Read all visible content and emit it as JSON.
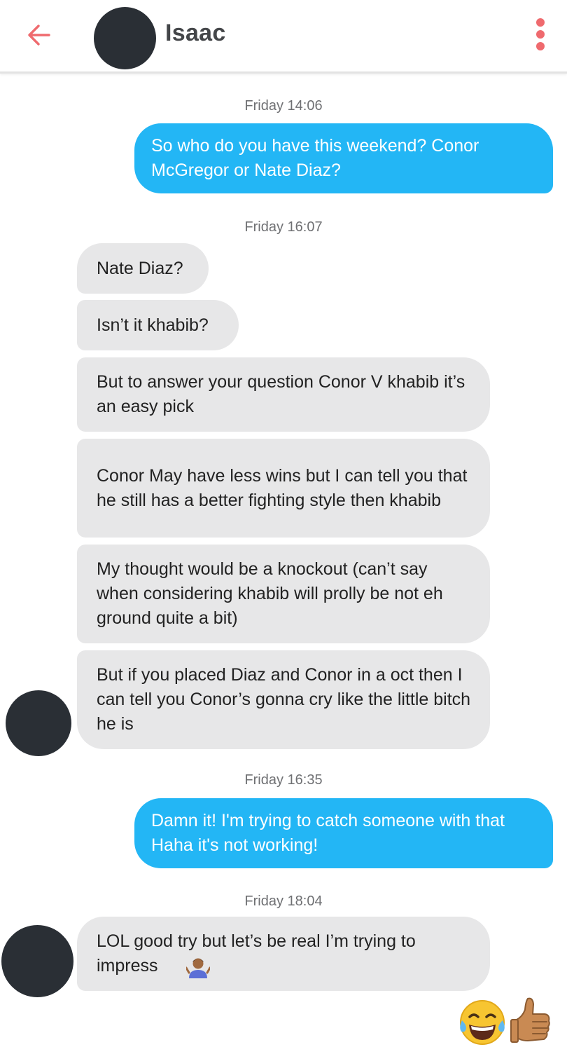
{
  "header": {
    "back_icon": "arrow-left-icon",
    "contact_name": "Isaac",
    "menu_icon": "more-vertical-icon",
    "accent_color": "#ef6a6e"
  },
  "colors": {
    "sent_bubble": "#23b6f5",
    "received_bubble": "#e7e7e8"
  },
  "conversation": {
    "ts1": "Friday 14:06",
    "m1": "So who do you have this weekend? Conor McGregor or Nate Diaz?",
    "ts2": "Friday 16:07",
    "m2": "Nate Diaz?",
    "m3": "Isn’t it khabib?",
    "m4": "But to answer your question Conor V khabib it’s an easy pick",
    "m5": "Conor May have less wins but I can tell you that he still has a better fighting style then khabib",
    "m6": "My thought would be a knockout (can’t say when considering khabib will prolly be not eh ground quite a bit)",
    "m7": "But if you placed Diaz and Conor in a oct then I can tell you Conor’s gonna cry like the little bitch he is",
    "ts3": "Friday 16:35",
    "m8": "Damn it! I'm trying to catch someone with that Haha it's not working!",
    "ts4": "Friday 18:04",
    "m9": "LOL good try but let’s be real I’m trying to impress",
    "m9_emoji": "person-shrugging-emoji"
  },
  "reaction_emojis": [
    "tears-of-joy-emoji",
    "thumbs-up-emoji"
  ]
}
